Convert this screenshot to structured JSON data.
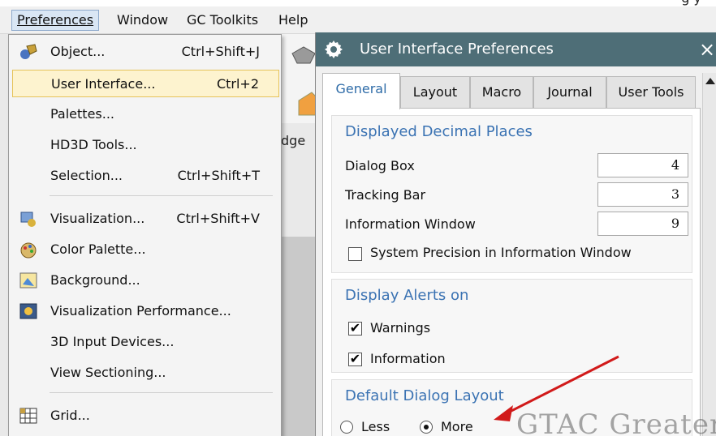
{
  "top_right_text": "g y",
  "menubar": {
    "items": [
      {
        "label": "Preferences",
        "active": true
      },
      {
        "label": "Window"
      },
      {
        "label": "GC Toolkits"
      },
      {
        "label": "Help"
      }
    ]
  },
  "background": {
    "partial_label": "dge"
  },
  "dropdown": {
    "items": [
      {
        "label": "Object...",
        "shortcut": "Ctrl+Shift+J",
        "icon": "object-icon"
      },
      {
        "label": "User Interface...",
        "shortcut": "Ctrl+2",
        "highlighted": true
      },
      {
        "label": "Palettes..."
      },
      {
        "label": "HD3D Tools..."
      },
      {
        "label": "Selection...",
        "shortcut": "Ctrl+Shift+T"
      },
      {
        "label": "Visualization...",
        "shortcut": "Ctrl+Shift+V",
        "icon": "visualization-icon"
      },
      {
        "label": "Color Palette...",
        "icon": "color-palette-icon"
      },
      {
        "label": "Background...",
        "icon": "background-icon"
      },
      {
        "label": "Visualization Performance...",
        "icon": "visualization-performance-icon"
      },
      {
        "label": "3D Input Devices..."
      },
      {
        "label": "View Sectioning..."
      },
      {
        "label": "Grid...",
        "icon": "grid-icon"
      }
    ]
  },
  "dialog": {
    "title": "User Interface Preferences",
    "close_glyph": "×",
    "tabs": [
      {
        "label": "General",
        "active": true
      },
      {
        "label": "Layout"
      },
      {
        "label": "Macro"
      },
      {
        "label": "Journal"
      },
      {
        "label": "User Tools"
      }
    ],
    "decimal_group": {
      "title": "Displayed Decimal Places",
      "fields": [
        {
          "label": "Dialog Box",
          "value": "4"
        },
        {
          "label": "Tracking Bar",
          "value": "3"
        },
        {
          "label": "Information Window",
          "value": "9"
        }
      ],
      "system_precision": {
        "label": "System Precision in Information Window",
        "checked": false
      }
    },
    "alerts_group": {
      "title": "Display Alerts on",
      "warnings": {
        "label": "Warnings",
        "checked": true
      },
      "information": {
        "label": "Information",
        "checked": true
      }
    },
    "layout_group": {
      "title": "Default Dialog Layout",
      "options": [
        {
          "label": "Less",
          "selected": false
        },
        {
          "label": "More",
          "selected": true
        }
      ]
    }
  },
  "watermark": "GTAC Greater",
  "colors": {
    "titlebar": "#4e6e77",
    "group_title": "#3b73b3",
    "active_tab_text": "#2f6ca8",
    "highlight": "#fdf3cf",
    "annotation_arrow": "#d11a1a"
  }
}
